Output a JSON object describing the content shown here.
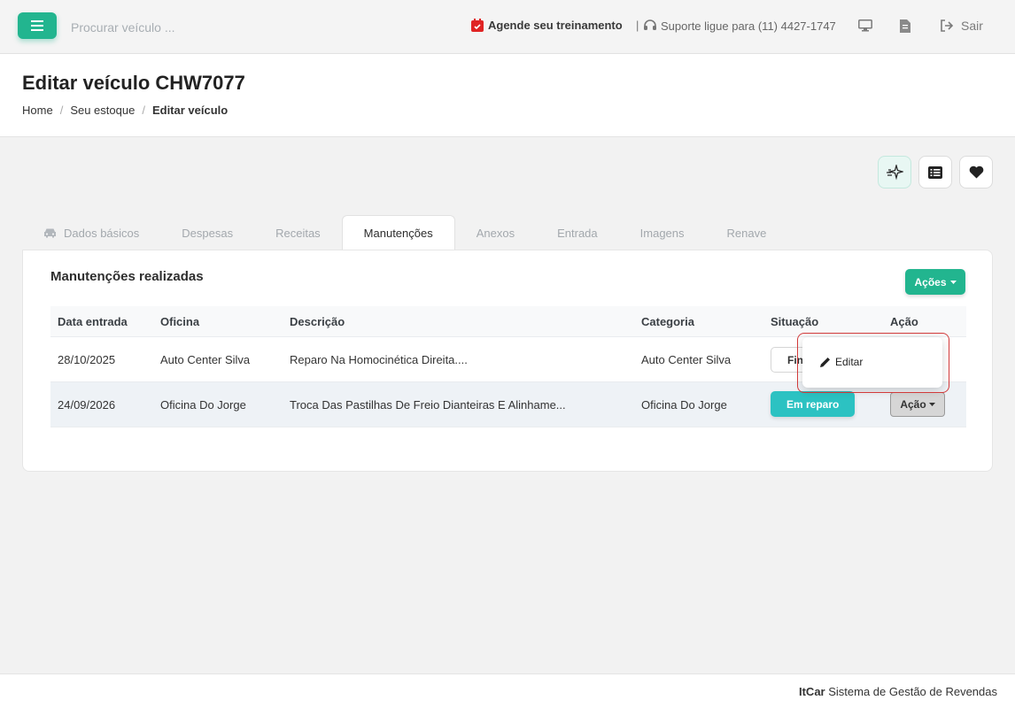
{
  "topbar": {
    "search_placeholder": "Procurar veículo ...",
    "training_label": "Agende seu treinamento",
    "separator": "|",
    "support_label": "Suporte ligue para (11) 4427-1747",
    "logout_label": "Sair"
  },
  "header": {
    "title": "Editar veículo CHW7077",
    "breadcrumb": [
      "Home",
      "Seu estoque",
      "Editar veículo"
    ]
  },
  "tabs": [
    {
      "label": "Dados básicos"
    },
    {
      "label": "Despesas"
    },
    {
      "label": "Receitas"
    },
    {
      "label": "Manutenções"
    },
    {
      "label": "Anexos"
    },
    {
      "label": "Entrada"
    },
    {
      "label": "Imagens"
    },
    {
      "label": "Renave"
    }
  ],
  "card": {
    "title": "Manutenções realizadas",
    "actions_label": "Ações",
    "columns": [
      "Data entrada",
      "Oficina",
      "Descrição",
      "Categoria",
      "Situação",
      "Ação"
    ],
    "rows": [
      {
        "date": "28/10/2025",
        "shop": "Auto Center Silva",
        "description": "Reparo Na Homocinética Direita....",
        "category": "Auto Center Silva",
        "status": "Fin"
      },
      {
        "date": "24/09/2026",
        "shop": "Oficina Do Jorge",
        "description": "Troca Das Pastilhas De Freio Dianteiras E Alinhame...",
        "category": "Oficina Do Jorge",
        "status": "Em reparo",
        "action": "Ação"
      }
    ]
  },
  "dropdown": {
    "edit_label": "Editar"
  },
  "footer": {
    "brand": "ItCar",
    "text": " Sistema de Gestão de Revendas"
  },
  "colors": {
    "accent": "#22b58f",
    "status_repair": "#2cc2c2",
    "highlight": "#d23a3a"
  },
  "icons": [
    "menu-icon",
    "calendar-icon",
    "headset-icon",
    "monitor-icon",
    "document-icon",
    "logout-icon",
    "sparkle-icon",
    "list-icon",
    "heart-icon",
    "car-icon",
    "pencil-icon",
    "caret-down-icon"
  ]
}
